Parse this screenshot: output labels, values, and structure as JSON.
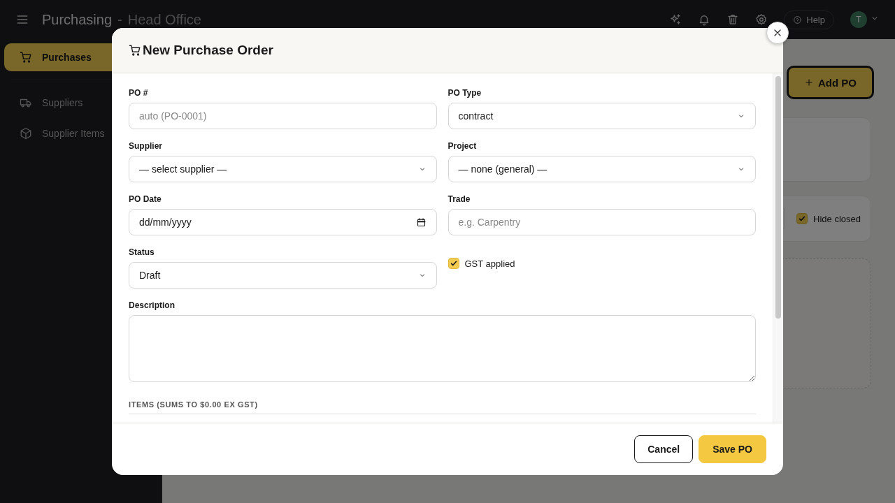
{
  "app_bar": {
    "title": "Purchasing",
    "separator": "-",
    "subtitle": "Head Office",
    "help": "Help",
    "avatar": "T"
  },
  "sidebar": {
    "items": [
      {
        "label": "Purchases",
        "kind": "cart",
        "selected": true
      },
      {
        "label": "Suppliers",
        "kind": "truck",
        "selected": false
      },
      {
        "label": "Supplier Items",
        "kind": "box",
        "selected": false
      }
    ]
  },
  "page": {
    "add_button": "Add PO",
    "filter": {
      "hide_closed": {
        "label": "Hide closed",
        "checked": true
      }
    }
  },
  "dialog": {
    "title": "New Purchase Order",
    "fields": [
      {
        "label": "PO #",
        "kind": "text",
        "placeholder": "auto (PO-0001)"
      },
      {
        "label": "PO Type",
        "kind": "select",
        "value": "contract"
      },
      {
        "label": "Supplier",
        "kind": "select",
        "value": "— select supplier —"
      },
      {
        "label": "Project",
        "kind": "select",
        "value": "— none (general) —"
      },
      {
        "label": "PO Date",
        "kind": "date",
        "value": "dd/mm/yyyy"
      },
      {
        "label": "Trade",
        "kind": "text",
        "placeholder": "e.g. Carpentry"
      },
      {
        "label": "Status",
        "kind": "select",
        "value": "Draft"
      },
      {
        "label": "GST applied",
        "kind": "checkbox",
        "checked": true
      },
      {
        "label": "Description",
        "kind": "textarea"
      }
    ],
    "section_heading": "ITEMS (SUMS TO $0.00 EX GST)",
    "buttons": [
      {
        "label": "Cancel",
        "kind": "secondary"
      },
      {
        "label": "Save PO",
        "kind": "primary"
      }
    ]
  }
}
